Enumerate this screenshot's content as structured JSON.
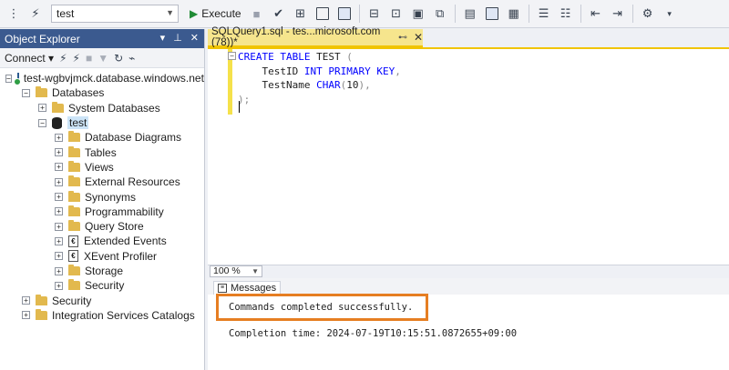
{
  "toolbar": {
    "database_selected": "test",
    "execute_label": "Execute"
  },
  "object_explorer": {
    "title": "Object Explorer",
    "connect_label": "Connect",
    "tree": [
      {
        "label": "test-wgbvjmck.database.windows.net (",
        "level": 0,
        "expander": "−",
        "icon": "server-icon"
      },
      {
        "label": "Databases",
        "level": 1,
        "expander": "−",
        "icon": "folder-icon"
      },
      {
        "label": "System Databases",
        "level": 2,
        "expander": "+",
        "icon": "folder-icon"
      },
      {
        "label": "test",
        "level": 2,
        "expander": "−",
        "icon": "database-icon"
      },
      {
        "label": "Database Diagrams",
        "level": 3,
        "expander": "+",
        "icon": "folder-icon"
      },
      {
        "label": "Tables",
        "level": 3,
        "expander": "+",
        "icon": "folder-icon"
      },
      {
        "label": "Views",
        "level": 3,
        "expander": "+",
        "icon": "folder-icon"
      },
      {
        "label": "External Resources",
        "level": 3,
        "expander": "+",
        "icon": "folder-icon"
      },
      {
        "label": "Synonyms",
        "level": 3,
        "expander": "+",
        "icon": "folder-icon"
      },
      {
        "label": "Programmability",
        "level": 3,
        "expander": "+",
        "icon": "folder-icon"
      },
      {
        "label": "Query Store",
        "level": 3,
        "expander": "+",
        "icon": "folder-icon"
      },
      {
        "label": "Extended Events",
        "level": 3,
        "expander": "+",
        "icon": "events-icon"
      },
      {
        "label": "XEvent Profiler",
        "level": 3,
        "expander": "+",
        "icon": "profiler-icon"
      },
      {
        "label": "Storage",
        "level": 3,
        "expander": "+",
        "icon": "folder-icon"
      },
      {
        "label": "Security",
        "level": 3,
        "expander": "+",
        "icon": "folder-icon"
      },
      {
        "label": "Security",
        "level": 1,
        "expander": "+",
        "icon": "folder-icon"
      },
      {
        "label": "Integration Services Catalogs",
        "level": 1,
        "expander": "+",
        "icon": "folder-icon"
      }
    ]
  },
  "editor": {
    "tab_title": "SQLQuery1.sql - tes...microsoft.com (78))*",
    "code": {
      "l1_kw1": "CREATE",
      "l1_kw2": "TABLE",
      "l1_name": " TEST ",
      "l1_paren": "(",
      "l2_col": "TestID ",
      "l2_type": "INT",
      "l2_sp": " ",
      "l2_pk": "PRIMARY KEY",
      "l2_comma": ",",
      "l3_col": "TestName ",
      "l3_type": "CHAR",
      "l3_open": "(",
      "l3_num": "10",
      "l3_close": "),",
      "l4": ");"
    },
    "zoom": "100 %"
  },
  "results": {
    "tab_label": "Messages",
    "message": "Commands completed successfully.",
    "completion": "Completion time: 2024-07-19T10:15:51.0872655+09:00"
  },
  "colors": {
    "accent_tab": "#f6e58d",
    "panel_title": "#3b5a8f",
    "highlight_box": "#e67e22",
    "keyword": "#0000ff"
  }
}
